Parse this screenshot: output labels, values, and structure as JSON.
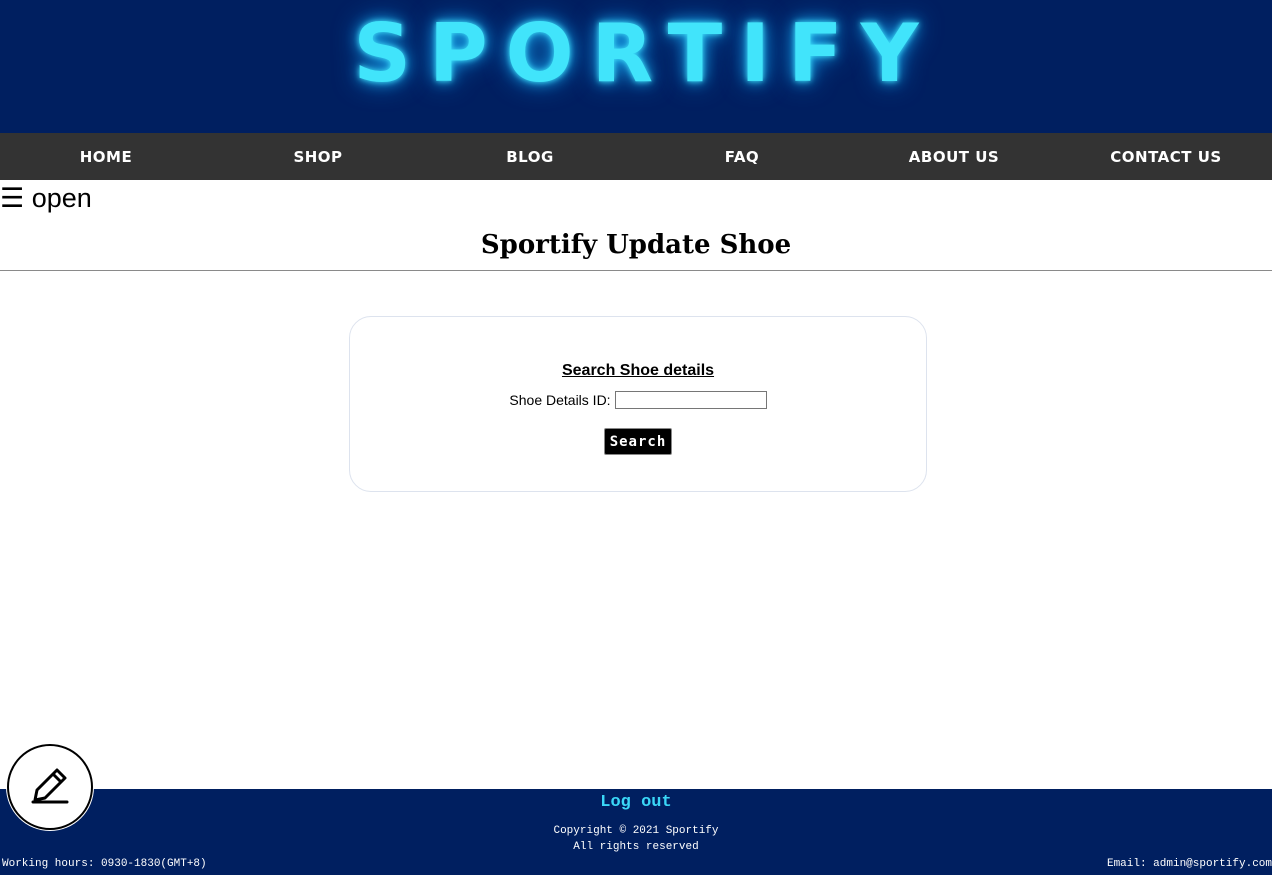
{
  "brand": {
    "logo_text": "SPORTIFY"
  },
  "nav": {
    "items": [
      {
        "label": "HOME"
      },
      {
        "label": "SHOP"
      },
      {
        "label": "BLOG"
      },
      {
        "label": "FAQ"
      },
      {
        "label": "ABOUT US"
      },
      {
        "label": "CONTACT US"
      }
    ]
  },
  "sidebar_toggle": {
    "icon": "menu-icon",
    "label": "☰ open"
  },
  "page": {
    "title": "Sportify Update Shoe"
  },
  "search_form": {
    "heading": "Search Shoe details",
    "id_label": "Shoe Details ID:",
    "id_value": "",
    "button_label": "Search"
  },
  "footer": {
    "logout_label": "Log out",
    "copyright_line1": "Copyright © 2021 Sportify",
    "copyright_line2": "All rights reserved",
    "hours": "Working hours: 0930-1830(GMT+8)",
    "email": "Email: admin@sportify.com"
  },
  "edit_button": {
    "icon": "pencil-icon"
  },
  "colors": {
    "header_bg": "#001f60",
    "nav_bg": "#333333",
    "logo_neon": "#41e4fb",
    "logout_link": "#3ad7f7",
    "button_bg": "#000000"
  }
}
